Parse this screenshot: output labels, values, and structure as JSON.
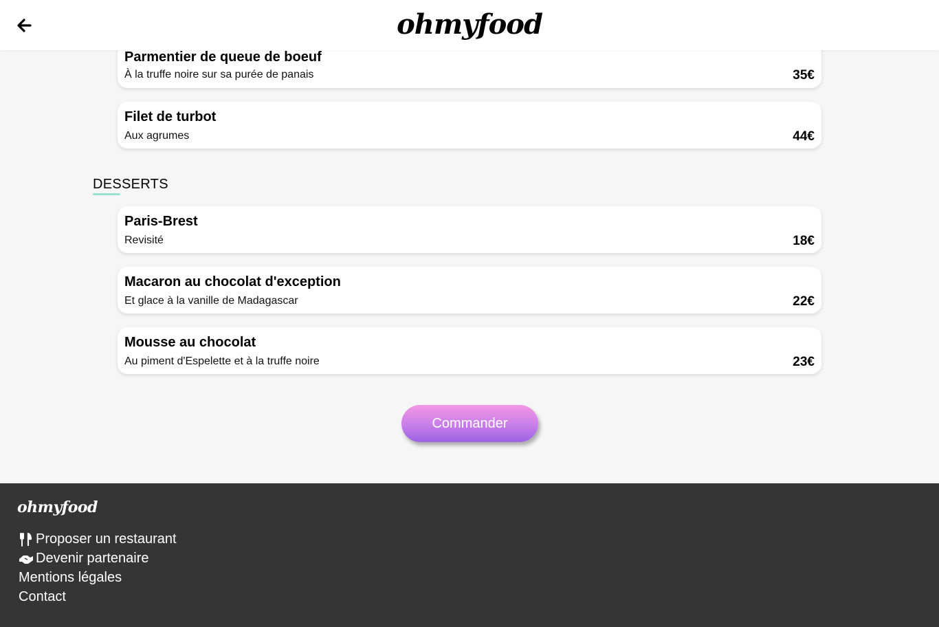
{
  "header": {
    "logo": "ohmyfood"
  },
  "menu": {
    "plats_partial": [
      {
        "name": "Parmentier de queue de boeuf",
        "description": "À la truffe noire sur sa purée de panais",
        "price": "35€"
      },
      {
        "name": "Filet de turbot",
        "description": "Aux agrumes",
        "price": "44€"
      }
    ],
    "desserts_title": "DESSERTS",
    "desserts": [
      {
        "name": "Paris-Brest",
        "description": "Revisité",
        "price": "18€"
      },
      {
        "name": "Macaron au chocolat d'exception",
        "description": "Et glace à la vanille de Madagascar",
        "price": "22€"
      },
      {
        "name": "Mousse au chocolat",
        "description": "Au piment d'Espelette et à la truffe noire",
        "price": "23€"
      }
    ]
  },
  "order_button": "Commander",
  "footer": {
    "logo": "ohmyfood",
    "links": [
      {
        "label": "Proposer un restaurant",
        "icon": "utensils-icon"
      },
      {
        "label": "Devenir partenaire",
        "icon": "handshake-icon"
      },
      {
        "label": "Mentions légales"
      },
      {
        "label": "Contact"
      }
    ]
  },
  "colors": {
    "accent_underline": "#99e2d0",
    "button_gradient_top": "#f398e4",
    "button_gradient_bottom": "#9b62e2",
    "footer_bg": "#353535",
    "page_bg": "#f6f6f6"
  }
}
